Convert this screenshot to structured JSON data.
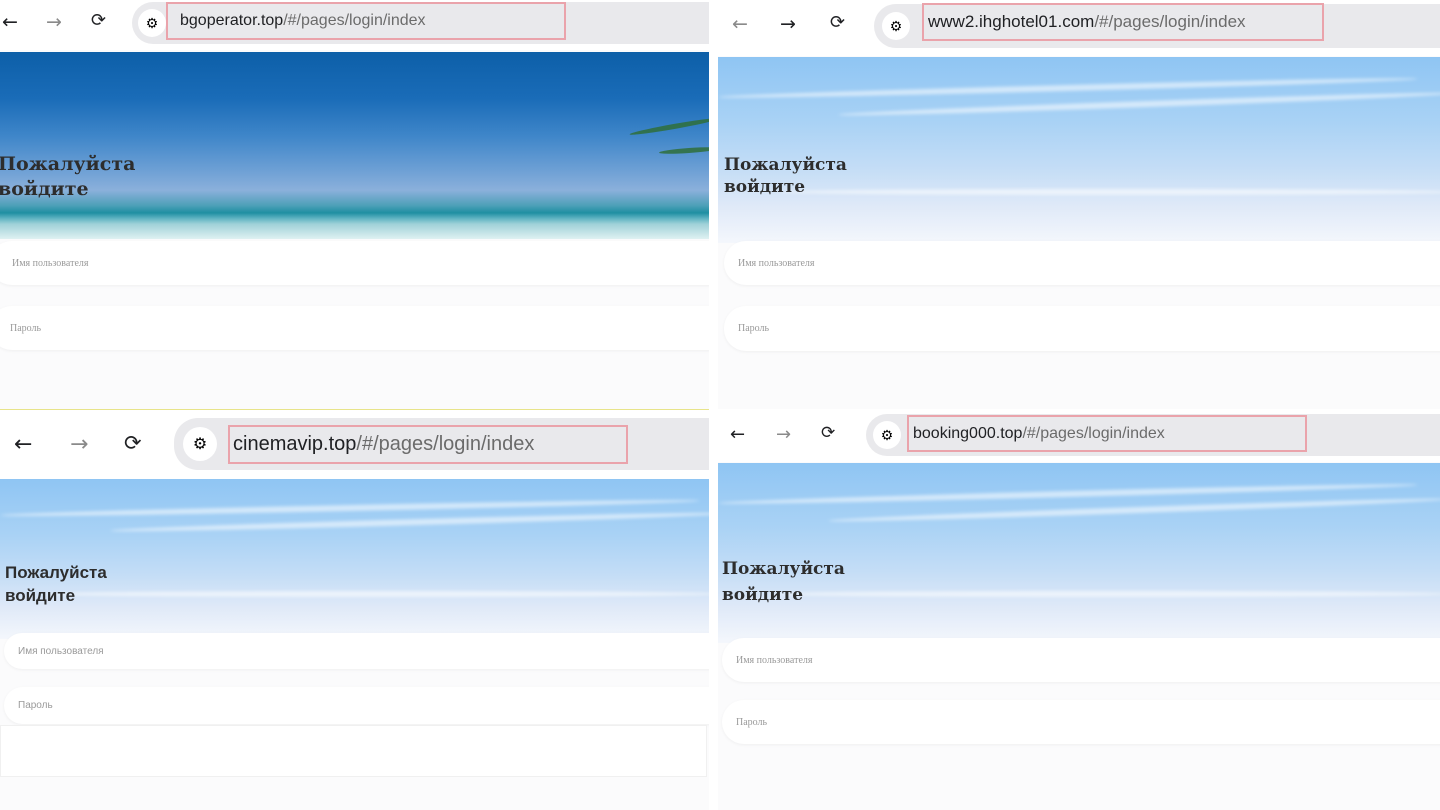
{
  "nav_icons": {
    "back": "←",
    "forward": "→",
    "reload": "⟳",
    "site_info": "⚙"
  },
  "panels": [
    {
      "url_host": "bgoperator.top",
      "url_path": "/#/pages/login/index",
      "title_line1": "Пожалуйста",
      "title_line2": "войдите",
      "username_placeholder": "Имя пользователя",
      "password_placeholder": "Пароль"
    },
    {
      "url_host": "www2.ihghotel01.com",
      "url_path": "/#/pages/login/index",
      "title_line1": "Пожалуйста",
      "title_line2": "войдите",
      "username_placeholder": "Имя пользователя",
      "password_placeholder": "Пароль"
    },
    {
      "url_host": "cinemavip.top",
      "url_path": "/#/pages/login/index",
      "title_line1": "Пожалуйста",
      "title_line2": "войдите",
      "username_placeholder": "Имя пользователя",
      "password_placeholder": "Пароль"
    },
    {
      "url_host": "booking000.top",
      "url_path": "/#/pages/login/index",
      "title_line1": "Пожалуйста",
      "title_line2": "войдите",
      "username_placeholder": "Имя пользователя",
      "password_placeholder": "Пароль"
    }
  ]
}
